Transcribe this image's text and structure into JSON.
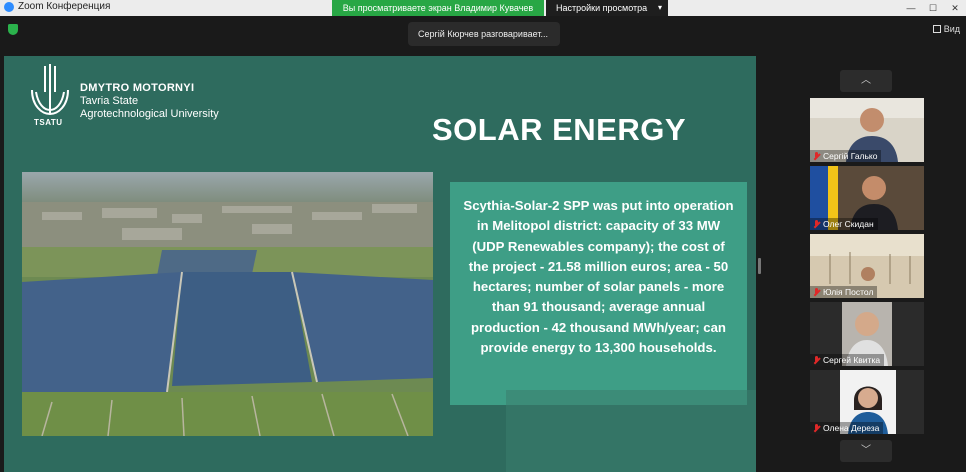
{
  "titlebar": {
    "app_title": "Zoom Конференция",
    "share_banner": "Вы просматриваете экран Владимир Кувачев",
    "view_options": "Настройки просмотра",
    "minimize": "—",
    "maximize": "☐",
    "close": "✕"
  },
  "meeting": {
    "speaker_toast": "Сергій Кюрчев разговаривает...",
    "view_label": "Вид"
  },
  "slide": {
    "logo_text": "TSATU",
    "university_line1": "DMYTRO MOTORNYI",
    "university_line2": "Tavria State",
    "university_line3": "Agrotechnological University",
    "title": "SOLAR ENERGY",
    "body": "Scythia-Solar-2 SPP was put into operation in Melitopol district: capacity of 33 MW (UDP Renewables company); the cost of the project - 21.58 million euros; area - 50 hectares; number of solar panels - more than 91 thousand; average annual production - 42 thousand MWh/year; can provide energy to 13,300 households."
  },
  "participants": [
    {
      "name": "Сергій Галько"
    },
    {
      "name": "Олег Скидан"
    },
    {
      "name": "Юлія Постол"
    },
    {
      "name": "Сергей Квитка"
    },
    {
      "name": "Олена Дереза"
    }
  ],
  "colors": {
    "slide_bg": "#2e6b5e",
    "textbox_bg": "#3e9e86",
    "share_banner": "#28a745",
    "mic_muted": "#e02828"
  }
}
